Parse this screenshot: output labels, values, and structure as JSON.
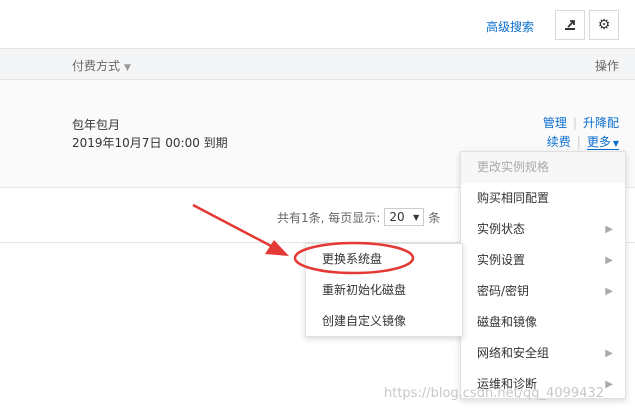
{
  "toolbar": {
    "advanced_search": "高级搜索",
    "export_icon": "export-icon",
    "settings_icon": "gear-icon"
  },
  "table": {
    "headers": {
      "payment": "付费方式",
      "operations": "操作"
    },
    "row": {
      "billing_type": "包年包月",
      "expiry": "2019年10月7日 00:00 到期",
      "actions": {
        "manage": "管理",
        "upgrade": "升降配",
        "renew": "续费",
        "more": "更多"
      }
    }
  },
  "pagination": {
    "summary_prefix": "共有1条, 每页显示:",
    "page_size": "20",
    "suffix": "条"
  },
  "context_menu": {
    "items": [
      {
        "label": "更改实例规格",
        "disabled": true,
        "has_submenu": false
      },
      {
        "label": "购买相同配置",
        "disabled": false,
        "has_submenu": false
      },
      {
        "label": "实例状态",
        "disabled": false,
        "has_submenu": true
      },
      {
        "label": "实例设置",
        "disabled": false,
        "has_submenu": true
      },
      {
        "label": "密码/密钥",
        "disabled": false,
        "has_submenu": true
      },
      {
        "label": "磁盘和镜像",
        "disabled": false,
        "has_submenu": false
      },
      {
        "label": "网络和安全组",
        "disabled": false,
        "has_submenu": true
      },
      {
        "label": "运维和诊断",
        "disabled": false,
        "has_submenu": true
      }
    ]
  },
  "submenu": {
    "items": [
      {
        "label": "更换系统盘"
      },
      {
        "label": "重新初始化磁盘"
      },
      {
        "label": "创建自定义镜像"
      }
    ]
  },
  "annotation": {
    "arrow_color": "#e53935",
    "circle_color": "#e53935"
  },
  "watermark": "https://blog.csdn.net/qq_4099432"
}
